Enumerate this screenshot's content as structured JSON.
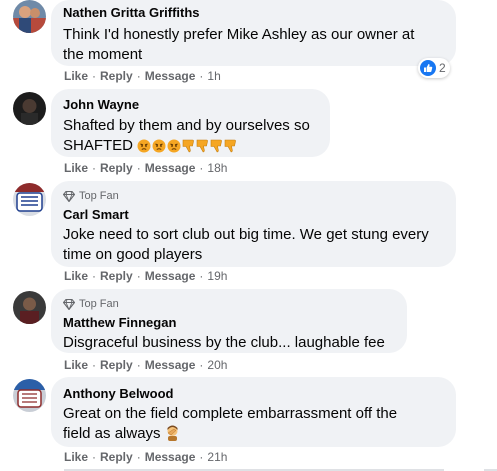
{
  "comments": [
    {
      "author": "Nathen Gritta Griffiths",
      "top_fan": false,
      "lines": [
        "Think I'd honestly prefer Mike Ashley as our owner at",
        "the moment"
      ],
      "actions": {
        "like": "Like",
        "reply": "Reply",
        "message": "Message"
      },
      "time": "1h",
      "reactions": {
        "icon": "like-icon",
        "count": "2"
      }
    },
    {
      "author": "John Wayne",
      "top_fan": false,
      "lines": [
        "Shafted by them and by ourselves so",
        "SHAFTED"
      ],
      "emojis": [
        "angry-face-icon",
        "angry-face-icon",
        "angry-face-icon",
        "thumbs-down-icon",
        "thumbs-down-icon",
        "thumbs-down-icon",
        "thumbs-down-icon"
      ],
      "actions": {
        "like": "Like",
        "reply": "Reply",
        "message": "Message"
      },
      "time": "18h"
    },
    {
      "author": "Carl Smart",
      "top_fan": true,
      "badge": "Top Fan",
      "lines": [
        "Joke need to sort club out big time. We get stung every",
        "time on good players"
      ],
      "actions": {
        "like": "Like",
        "reply": "Reply",
        "message": "Message"
      },
      "time": "19h"
    },
    {
      "author": "Matthew Finnegan",
      "top_fan": true,
      "badge": "Top Fan",
      "lines": [
        "Disgraceful business by the club... laughable fee"
      ],
      "actions": {
        "like": "Like",
        "reply": "Reply",
        "message": "Message"
      },
      "time": "20h"
    },
    {
      "author": "Anthony Belwood",
      "top_fan": false,
      "lines": [
        "Great on the field complete embarrassment off the",
        "field as always"
      ],
      "emojis": [
        "facepalm-icon"
      ],
      "actions": {
        "like": "Like",
        "reply": "Reply",
        "message": "Message"
      },
      "time": "21h"
    }
  ],
  "colors": {
    "bubble": "#f0f2f5",
    "meta_text": "#65676b",
    "like_blue": "#1877f2",
    "body_text": "#050505"
  }
}
